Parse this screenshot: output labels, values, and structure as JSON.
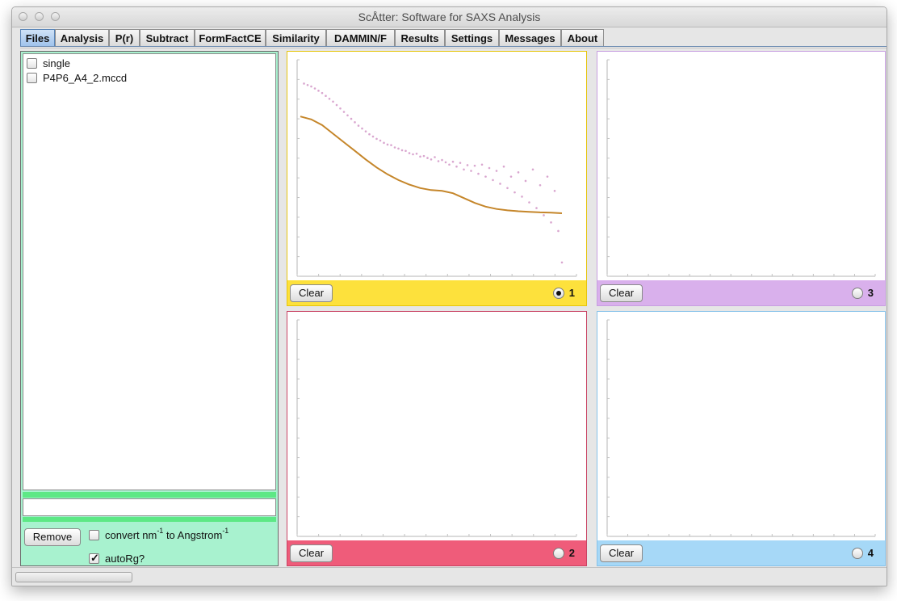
{
  "window": {
    "title": "ScÅtter: Software for SAXS Analysis"
  },
  "tabs": [
    {
      "label": "Files",
      "active": true
    },
    {
      "label": "Analysis"
    },
    {
      "label": "P(r)"
    },
    {
      "label": "Subtract"
    },
    {
      "label": "FormFactCE"
    },
    {
      "label": "Similarity"
    },
    {
      "label": "DAMMIN/F"
    },
    {
      "label": "Results"
    },
    {
      "label": "Settings"
    },
    {
      "label": "Messages"
    },
    {
      "label": "About"
    }
  ],
  "files": {
    "items": [
      {
        "label": "single",
        "checked": false
      },
      {
        "label": "P4P6_A4_2.mccd",
        "checked": false
      }
    ],
    "input_value": "",
    "remove_label": "Remove",
    "convert_prefix": "convert nm",
    "convert_exp": "-1",
    "convert_middle": " to Angstrom",
    "convert_exp2": "-1",
    "convert_checked": false,
    "autorg_label": "autoRg?",
    "autorg_checked": true,
    "panel_color": "#a8f2cf",
    "bar_color": "#5de885"
  },
  "plots": [
    {
      "id": "1",
      "clear_label": "Clear",
      "selected": true,
      "color": "#fde13c",
      "border": "#e6c50b"
    },
    {
      "id": "3",
      "clear_label": "Clear",
      "selected": false,
      "color": "#d9b0ec",
      "border": "#c79ee0"
    },
    {
      "id": "2",
      "clear_label": "Clear",
      "selected": false,
      "color": "#ef5c7a",
      "border": "#c94263"
    },
    {
      "id": "4",
      "clear_label": "Clear",
      "selected": false,
      "color": "#a6d8f7",
      "border": "#86c2ea"
    }
  ],
  "chart_data": {
    "type": "scatter",
    "title": "",
    "xlabel": "",
    "ylabel": "",
    "series": [
      {
        "kind": "points",
        "color": "#d9a6cf",
        "x": [
          0.01,
          0.02,
          0.03,
          0.04,
          0.05,
          0.06,
          0.07,
          0.08,
          0.09,
          0.1,
          0.11,
          0.12,
          0.13,
          0.14,
          0.15,
          0.16,
          0.17,
          0.18,
          0.19,
          0.2,
          0.21,
          0.22,
          0.23,
          0.24,
          0.25,
          0.26,
          0.27,
          0.28,
          0.29,
          0.3,
          0.31,
          0.32,
          0.33,
          0.34,
          0.35,
          0.36,
          0.37,
          0.38,
          0.39,
          0.4,
          0.41,
          0.42,
          0.43,
          0.44,
          0.45,
          0.46,
          0.47,
          0.48,
          0.49,
          0.5,
          0.51,
          0.52,
          0.53,
          0.54,
          0.55,
          0.56,
          0.57,
          0.58,
          0.59,
          0.6,
          0.61,
          0.62,
          0.63,
          0.64,
          0.65,
          0.66,
          0.67,
          0.68,
          0.69,
          0.7,
          0.71,
          0.72
        ],
        "y": [
          9.45,
          9.4,
          9.35,
          9.28,
          9.2,
          9.12,
          9.02,
          8.92,
          8.82,
          8.7,
          8.58,
          8.46,
          8.34,
          8.22,
          8.1,
          7.98,
          7.88,
          7.78,
          7.68,
          7.6,
          7.52,
          7.46,
          7.38,
          7.32,
          7.3,
          7.22,
          7.18,
          7.12,
          7.1,
          7.02,
          6.98,
          7.0,
          6.9,
          6.92,
          6.85,
          6.8,
          6.88,
          6.74,
          6.78,
          6.7,
          6.62,
          6.72,
          6.55,
          6.68,
          6.45,
          6.6,
          6.4,
          6.58,
          6.3,
          6.62,
          6.2,
          6.5,
          6.08,
          6.4,
          5.95,
          6.55,
          5.8,
          6.2,
          5.65,
          6.35,
          5.5,
          6.05,
          5.3,
          6.45,
          5.1,
          5.9,
          4.85,
          6.2,
          4.6,
          5.7,
          4.3,
          3.2
        ]
      },
      {
        "kind": "line",
        "color": "#c5862a",
        "x": [
          0.0,
          0.03,
          0.06,
          0.09,
          0.12,
          0.15,
          0.18,
          0.21,
          0.24,
          0.27,
          0.3,
          0.33,
          0.36,
          0.39,
          0.42,
          0.45,
          0.48,
          0.51,
          0.54,
          0.57,
          0.6,
          0.63,
          0.66,
          0.69,
          0.72
        ],
        "y": [
          8.3,
          8.2,
          8.0,
          7.7,
          7.4,
          7.1,
          6.8,
          6.52,
          6.28,
          6.08,
          5.92,
          5.8,
          5.73,
          5.7,
          5.62,
          5.45,
          5.28,
          5.15,
          5.07,
          5.02,
          4.99,
          4.97,
          4.95,
          4.94,
          4.92
        ]
      }
    ],
    "xlim": [
      0.0,
      0.72
    ],
    "ylim": [
      3.0,
      10.0
    ],
    "grid": false
  }
}
